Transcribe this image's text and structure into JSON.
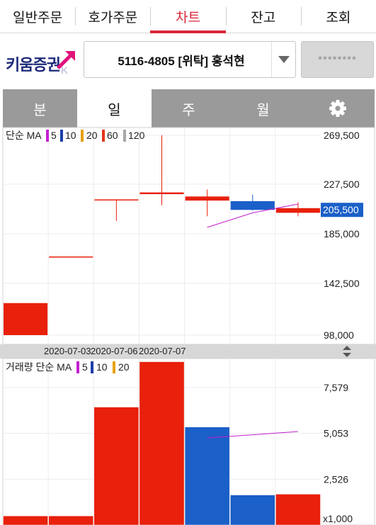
{
  "top_tabs": [
    {
      "label": "일반주문",
      "active": false
    },
    {
      "label": "호가주문",
      "active": false
    },
    {
      "label": "차트",
      "active": true
    },
    {
      "label": "잔고",
      "active": false
    },
    {
      "label": "조회",
      "active": false
    }
  ],
  "brand": {
    "logo_text": "키움증권"
  },
  "account": {
    "label": "5116-4805 [위탁] 홍석현",
    "password_mask": "********"
  },
  "period_tabs": [
    {
      "label": "분",
      "active": false
    },
    {
      "label": "일",
      "active": true
    },
    {
      "label": "주",
      "active": false
    },
    {
      "label": "월",
      "active": false
    }
  ],
  "colors": {
    "up": "#e8200c",
    "down": "#1b5fc8",
    "ma5": "#c21fcf",
    "ma10": "#1a3fa8",
    "ma20": "#e6a100",
    "ma60": "#e5351a",
    "ma120": "#a8a8a8",
    "accent": "#d8263a"
  },
  "price_legend": {
    "title": "단순 MA",
    "items": [
      {
        "label": "5",
        "color": "#c21fcf"
      },
      {
        "label": "10",
        "color": "#1a3fa8"
      },
      {
        "label": "20",
        "color": "#e6a100"
      },
      {
        "label": "60",
        "color": "#e5351a"
      },
      {
        "label": "120",
        "color": "#a8a8a8"
      }
    ]
  },
  "volume_legend": {
    "title": "거래량 단순 MA",
    "items": [
      {
        "label": "5",
        "color": "#c21fcf"
      },
      {
        "label": "10",
        "color": "#1a3fa8"
      },
      {
        "label": "20",
        "color": "#e6a100"
      }
    ]
  },
  "price_axis": {
    "ticks": [
      "269,500",
      "227,500",
      "185,000",
      "142,500",
      "98,000"
    ],
    "current_price": "205,500"
  },
  "volume_axis": {
    "ticks": [
      "7,579",
      "5,053",
      "2,526"
    ],
    "unit": "x1,000"
  },
  "date_labels": [
    "2020-07-03",
    "2020-07-06",
    "2020-07-07"
  ],
  "chart_data": [
    {
      "type": "candlestick",
      "title": "",
      "ylim": [
        98000,
        269500
      ],
      "candles": [
        {
          "open": 98000,
          "close": 125500,
          "high": 125500,
          "low": 98000,
          "dir": "up"
        },
        {
          "open": 165000,
          "close": 165500,
          "high": 165500,
          "low": 165000,
          "dir": "up"
        },
        {
          "open": 214000,
          "close": 214500,
          "high": 214500,
          "low": 196000,
          "dir": "up"
        },
        {
          "open": 219000,
          "close": 220500,
          "high": 269500,
          "low": 209500,
          "dir": "up"
        },
        {
          "open": 213500,
          "close": 217000,
          "high": 223000,
          "low": 200000,
          "dir": "up"
        },
        {
          "open": 213000,
          "close": 205500,
          "high": 218500,
          "low": 205000,
          "dir": "down"
        },
        {
          "open": 203000,
          "close": 207000,
          "high": 212000,
          "low": 200000,
          "dir": "up"
        }
      ],
      "ma5": [
        null,
        null,
        null,
        null,
        190500,
        203000,
        210500
      ]
    },
    {
      "type": "bar",
      "title": "",
      "unit": "x1,000",
      "ylim": [
        0,
        9100
      ],
      "values": [
        500,
        500,
        6500,
        9000,
        5400,
        1650,
        1700
      ],
      "dirs": [
        "up",
        "up",
        "up",
        "up",
        "down",
        "down",
        "up"
      ],
      "ma5": [
        null,
        null,
        null,
        null,
        4800,
        null,
        5150
      ]
    }
  ]
}
